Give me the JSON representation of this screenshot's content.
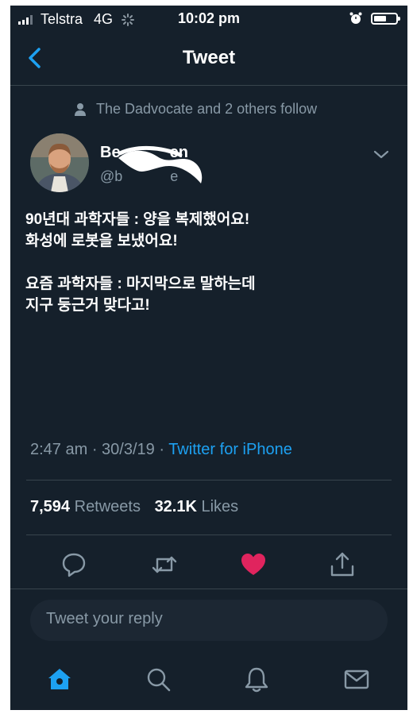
{
  "status_bar": {
    "carrier": "Telstra",
    "network": "4G",
    "time": "10:02 pm"
  },
  "nav": {
    "title": "Tweet"
  },
  "tweet": {
    "social_context": "The Dadvocate and 2 others follow",
    "author_name": "Be",
    "author_name_tail": "en",
    "author_handle": "@b",
    "author_handle_tail": "e",
    "text": "90년대 과학자들 : 양을 복제했어요!\n화성에 로봇을 보냈어요!\n\n요즘 과학자들 : 마지막으로 말하는데\n지구 둥근거 맞다고!",
    "time": "2:47 am · 30/3/19 · ",
    "source": "Twitter for iPhone",
    "retweets_count": "7,594",
    "retweets_label": " Retweets",
    "likes_count": "32.1K",
    "likes_label": " Likes"
  },
  "actions": [
    "reply-icon",
    "retweet-icon",
    "like-icon",
    "share-icon"
  ],
  "reply": {
    "placeholder": "Tweet your reply"
  },
  "tabbar": [
    "home-icon",
    "search-icon",
    "notifications-icon",
    "messages-icon"
  ],
  "colors": {
    "background": "#15202b",
    "accent": "#1da1f2",
    "like": "#e0245e",
    "secondary_text": "#8899a6"
  }
}
